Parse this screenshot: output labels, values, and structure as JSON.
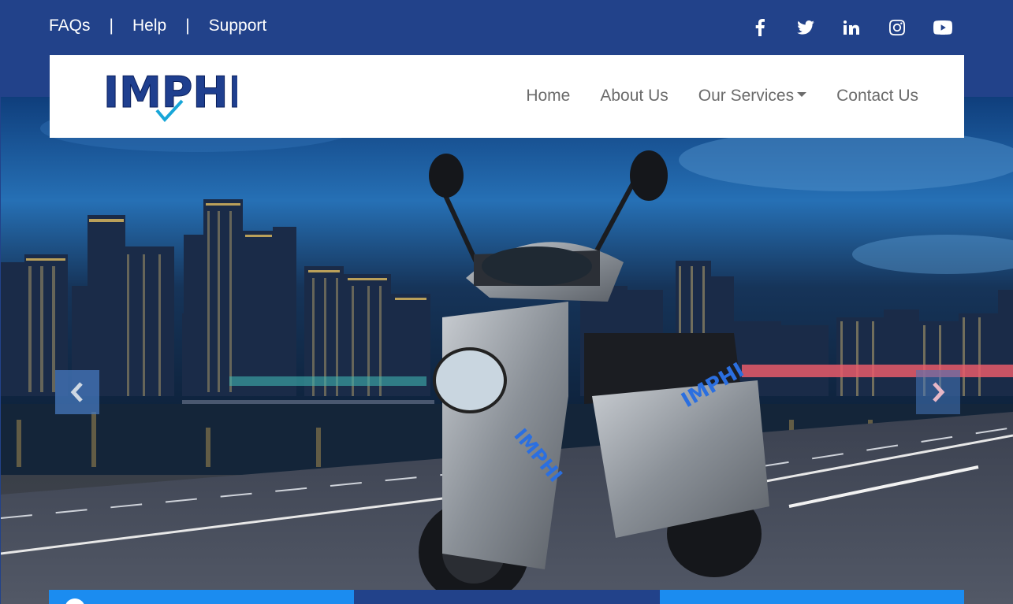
{
  "topbar": {
    "links": [
      {
        "label": "FAQs"
      },
      {
        "label": "Help"
      },
      {
        "label": "Support"
      }
    ],
    "separator": "|",
    "social": [
      "facebook-icon",
      "twitter-icon",
      "linkedin-icon",
      "instagram-icon",
      "youtube-icon"
    ]
  },
  "navbar": {
    "logo_text": "IMPHI",
    "items": [
      {
        "label": "Home"
      },
      {
        "label": "About Us"
      },
      {
        "label": "Our Services",
        "dropdown": true
      },
      {
        "label": "Contact Us"
      }
    ]
  },
  "hero": {
    "scooter_brand": "IMPHI",
    "controls": {
      "prev": "chevron-left-icon",
      "next": "chevron-right-icon"
    }
  },
  "colors": {
    "brand_navy": "#22428a",
    "accent_blue": "#1b8cf0",
    "nav_text": "#6b6b6b"
  }
}
